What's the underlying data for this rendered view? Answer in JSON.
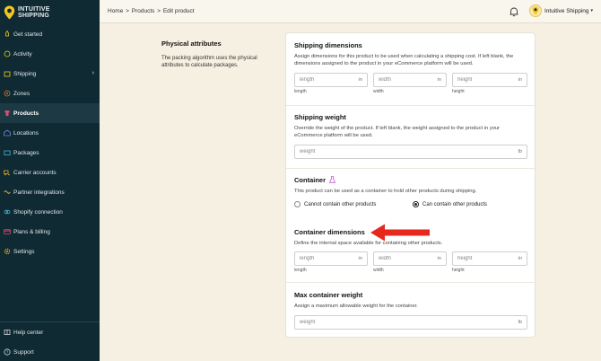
{
  "brand": {
    "line1": "INTUITIVE",
    "line2": "SHIPPING"
  },
  "sidebar": {
    "items": [
      {
        "label": "Get started",
        "icon": "rocket-icon"
      },
      {
        "label": "Activity",
        "icon": "activity-icon"
      },
      {
        "label": "Shipping",
        "icon": "box-icon",
        "has_children": true
      },
      {
        "label": "Zones",
        "icon": "zones-icon"
      },
      {
        "label": "Products",
        "icon": "shirt-icon",
        "active": true
      },
      {
        "label": "Locations",
        "icon": "warehouse-icon"
      },
      {
        "label": "Packages",
        "icon": "package-icon"
      },
      {
        "label": "Carrier accounts",
        "icon": "truck-icon"
      },
      {
        "label": "Partner integrations",
        "icon": "handshake-icon"
      },
      {
        "label": "Shopify connection",
        "icon": "link-icon"
      },
      {
        "label": "Plans & billing",
        "icon": "card-icon"
      },
      {
        "label": "Settings",
        "icon": "gear-icon"
      }
    ],
    "bottom": [
      {
        "label": "Help center",
        "icon": "book-icon"
      },
      {
        "label": "Support",
        "icon": "help-circle-icon"
      }
    ]
  },
  "breadcrumb": {
    "home": "Home",
    "sep": ">",
    "products": "Products",
    "current": "Edit product"
  },
  "user": {
    "name": "Intuitive Shipping",
    "caret": "▾"
  },
  "left": {
    "title": "Physical attributes",
    "desc": "The packing algorithm uses the physical attributes to calculate packages."
  },
  "shipping_dimensions": {
    "title": "Shipping dimensions",
    "desc": "Assign dimensions for this product to be used when calculating a shipping cost. If left blank, the dimensions assigned to the product in your eCommerce platform will be used.",
    "fields": [
      {
        "placeholder": "length",
        "unit": "in",
        "sublabel": "length"
      },
      {
        "placeholder": "width",
        "unit": "in",
        "sublabel": "width"
      },
      {
        "placeholder": "height",
        "unit": "in",
        "sublabel": "height"
      }
    ]
  },
  "shipping_weight": {
    "title": "Shipping weight",
    "desc": "Override the weight of the product. If left blank, the weight assigned to the product in your eCommerce platform will be used.",
    "placeholder": "weight",
    "unit": "lb"
  },
  "container": {
    "title": "Container",
    "desc": "This product can be used as a container to hold other products during shipping.",
    "options": [
      {
        "label": "Cannot contain other products",
        "selected": false
      },
      {
        "label": "Can contain other products",
        "selected": true
      }
    ]
  },
  "container_dimensions": {
    "title": "Container dimensions",
    "desc": "Define the internal space available for containing other products.",
    "fields": [
      {
        "placeholder": "length",
        "unit": "in",
        "sublabel": "length"
      },
      {
        "placeholder": "width",
        "unit": "in",
        "sublabel": "width"
      },
      {
        "placeholder": "height",
        "unit": "in",
        "sublabel": "height"
      }
    ]
  },
  "max_container_weight": {
    "title": "Max container weight",
    "desc": "Assign a maximum allowable weight for the container.",
    "placeholder": "weight",
    "unit": "lb"
  },
  "colors": {
    "sidebar": "#0f2a33",
    "background": "#f6f0e2",
    "accent_arrow": "#e5291c",
    "brand_yellow": "#f3c623"
  }
}
